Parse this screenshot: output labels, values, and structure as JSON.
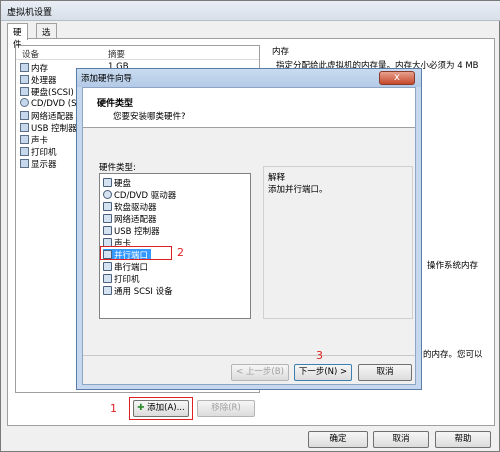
{
  "window": {
    "title": "虚拟机设置"
  },
  "tabs": [
    {
      "label": "硬件"
    },
    {
      "label": "选项"
    }
  ],
  "device_table": {
    "col_device": "设备",
    "col_summary": "摘要",
    "rows": [
      {
        "device": "内存",
        "summary": "1 GB",
        "icon": "memory-icon"
      },
      {
        "device": "处理器",
        "icon": "cpu-icon"
      },
      {
        "device": "硬盘(SCSI)",
        "icon": "disk-icon"
      },
      {
        "device": "CD/DVD (S/",
        "icon": "cd-icon"
      },
      {
        "device": "网络适配器",
        "icon": "network-icon"
      },
      {
        "device": "USB 控制器",
        "icon": "usb-icon"
      },
      {
        "device": "声卡",
        "icon": "sound-icon"
      },
      {
        "device": "打印机",
        "icon": "printer-icon"
      },
      {
        "device": "显示器",
        "icon": "display-icon"
      }
    ]
  },
  "right_panel": {
    "memory_heading": "内存",
    "memory_desc": "指定分配给此虚拟机的内存量。内存大小必须为 4 MB",
    "text_fragment_1": "操作系统内存",
    "text_fragment_2": "的内存。您可以"
  },
  "bottom_buttons": {
    "add": "添加(A)...",
    "remove": "移除(R)"
  },
  "dialog_buttons": {
    "ok": "确定",
    "cancel": "取消",
    "help": "帮助"
  },
  "wizard": {
    "title": "添加硬件向导",
    "close": "x",
    "heading": "硬件类型",
    "subheading": "您要安装哪类硬件?",
    "list_label": "硬件类型:",
    "items": [
      {
        "label": "硬盘",
        "icon": "disk-icon"
      },
      {
        "label": "CD/DVD 驱动器",
        "icon": "cd-icon"
      },
      {
        "label": "软盘驱动器",
        "icon": "floppy-icon"
      },
      {
        "label": "网络适配器",
        "icon": "network-icon"
      },
      {
        "label": "USB 控制器",
        "icon": "usb-icon"
      },
      {
        "label": "声卡",
        "icon": "sound-icon"
      },
      {
        "label": "并行端口",
        "icon": "parallel-port-icon",
        "selected": true
      },
      {
        "label": "串行端口",
        "icon": "serial-port-icon"
      },
      {
        "label": "打印机",
        "icon": "printer-icon"
      },
      {
        "label": "通用 SCSI 设备",
        "icon": "scsi-icon"
      }
    ],
    "explanation_label": "解释",
    "explanation_text": "添加并行端口。",
    "back": "< 上一步(B)",
    "next": "下一步(N) >",
    "cancel": "取消"
  },
  "annotations": {
    "n1": "1",
    "n2": "2",
    "n3": "3"
  },
  "colors": {
    "annotation": "#e02020",
    "selection": "#3399ff"
  }
}
